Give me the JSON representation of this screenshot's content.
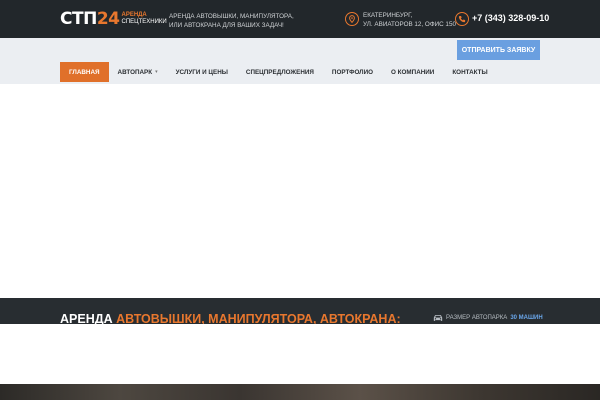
{
  "header": {
    "logo_main": "СТП",
    "logo_num": "24",
    "logo_sub_1": "АРЕНДА",
    "logo_sub_2": "СПЕЦТЕХНИКИ",
    "tagline_1": "АРЕНДА АВТОВЫШКИ, МАНИПУЛЯТОРА,",
    "tagline_2": "ИЛИ АВТОКРАНА ДЛЯ ВАШИХ ЗАДАЧ!",
    "address_city": "ЕКАТЕРИНБУРГ,",
    "address_street": "УЛ. АВИАТОРОВ 12, ОФИС 150",
    "phone": "+7 (343) 328-09-10",
    "cta_label": "ОТПРАВИТЬ ЗАЯВКУ"
  },
  "menu": {
    "items": [
      {
        "label": "ГЛАВНАЯ",
        "active": true
      },
      {
        "label": "АВТОПАРК",
        "caret": "▾"
      },
      {
        "label": "УСЛУГИ И ЦЕНЫ"
      },
      {
        "label": "СПЕЦПРЕДЛОЖЕНИЯ"
      },
      {
        "label": "ПОРТФОЛИО"
      },
      {
        "label": "О КОМПАНИИ"
      },
      {
        "label": "КОНТАКТЫ"
      }
    ]
  },
  "banner": {
    "headline_plain": "АРЕНДА ",
    "headline_accent": "АВТОВЫШКИ, МАНИПУЛЯТОРА, АВТОКРАНА:",
    "fleet_label": "РАЗМЕР АВТОПАРКА",
    "fleet_value": "30 МАШИН"
  },
  "icons": {
    "address": "location-pin-icon",
    "phone": "phone-icon",
    "fleet": "car-icon"
  },
  "colors": {
    "accent": "#e8772e",
    "cta": "#6a9fe0",
    "topbar": "#22272b",
    "nav_bg": "#ebeef2"
  }
}
